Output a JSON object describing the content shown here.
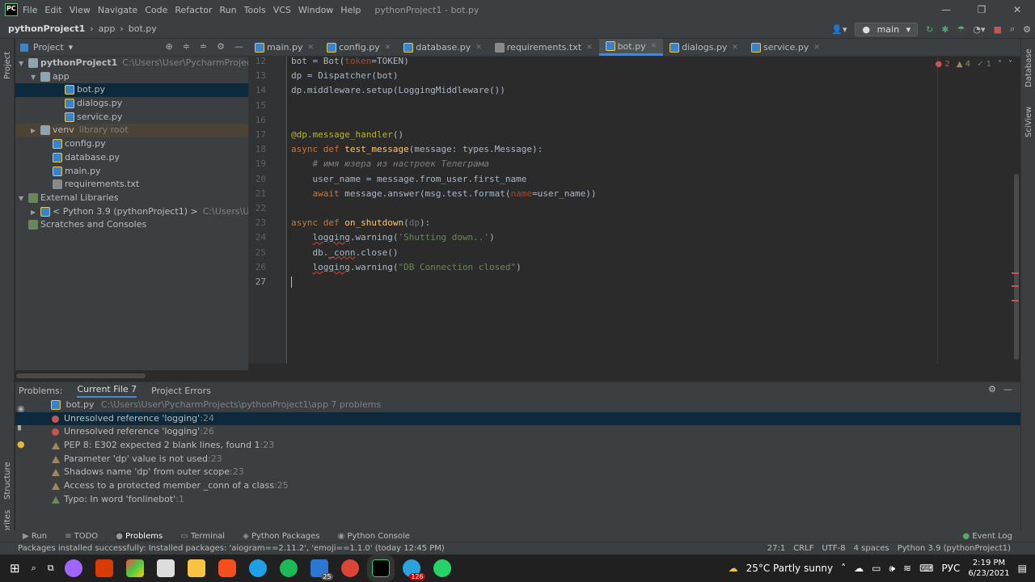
{
  "app": {
    "menu": [
      "File",
      "Edit",
      "View",
      "Navigate",
      "Code",
      "Refactor",
      "Run",
      "Tools",
      "VCS",
      "Window",
      "Help"
    ],
    "title": "pythonProject1 - bot.py"
  },
  "nav": {
    "crumbs": [
      "pythonProject1",
      "app",
      "bot.py"
    ],
    "branch": "main"
  },
  "project_panel": {
    "title": "Project",
    "rows": [
      {
        "name": "pythonProject1",
        "extra": "C:\\Users\\User\\PycharmProjects\\pythonPr",
        "kind": "folder",
        "indent": 0,
        "bold": true
      },
      {
        "name": "app",
        "extra": "",
        "kind": "folder",
        "indent": 1
      },
      {
        "name": "bot.py",
        "extra": "",
        "kind": "py",
        "indent": 3,
        "selected": true
      },
      {
        "name": "dialogs.py",
        "extra": "",
        "kind": "py",
        "indent": 3
      },
      {
        "name": "service.py",
        "extra": "",
        "kind": "py",
        "indent": 3
      },
      {
        "name": "venv",
        "extra": "library root",
        "kind": "folder",
        "indent": 1,
        "venv": true
      },
      {
        "name": "config.py",
        "extra": "",
        "kind": "py",
        "indent": 2
      },
      {
        "name": "database.py",
        "extra": "",
        "kind": "py",
        "indent": 2
      },
      {
        "name": "main.py",
        "extra": "",
        "kind": "py",
        "indent": 2
      },
      {
        "name": "requirements.txt",
        "extra": "",
        "kind": "txt",
        "indent": 2
      },
      {
        "name": "External Libraries",
        "extra": "",
        "kind": "lib",
        "indent": 0
      },
      {
        "name": "< Python 3.9 (pythonProject1) >",
        "extra": "C:\\Users\\User\\Pycharm",
        "kind": "py",
        "indent": 1
      },
      {
        "name": "Scratches and Consoles",
        "extra": "",
        "kind": "lib",
        "indent": 0
      }
    ]
  },
  "tabs": [
    "main.py",
    "config.py",
    "database.py",
    "requirements.txt",
    "bot.py",
    "dialogs.py",
    "service.py"
  ],
  "active_tab": "bot.py",
  "inspections": {
    "errors": "2",
    "warnings": "4",
    "typos": "1"
  },
  "code_lines": [
    {
      "n": "12",
      "html": "bot = Bot(<span class=\"pm\">token</span>=TOKEN)"
    },
    {
      "n": "13",
      "html": "dp = Dispatcher(bot)"
    },
    {
      "n": "14",
      "html": "dp.middleware.setup(LoggingMiddleware())"
    },
    {
      "n": "15",
      "html": ""
    },
    {
      "n": "16",
      "html": ""
    },
    {
      "n": "17",
      "html": "<span class=\"dec\">@dp.message_handler</span>()"
    },
    {
      "n": "18",
      "html": "<span class=\"kw\">async def </span><span class=\"fn\">test_message</span>(message: types.Message):"
    },
    {
      "n": "19",
      "html": "    <span class=\"cm\"># имя юзера из настроек Телеграма</span>"
    },
    {
      "n": "20",
      "html": "    user_name = message.from_user.first_name"
    },
    {
      "n": "21",
      "html": "    <span class=\"kw\">await </span>message.answer(msg.test.format(<span class=\"pm\">name</span>=user_name))"
    },
    {
      "n": "22",
      "html": ""
    },
    {
      "n": "23",
      "html": "<span class=\"kw\">async def </span><span class=\"fn\">on_shutdown</span>(<span class=\"gray\">dp</span>):"
    },
    {
      "n": "24",
      "html": "    <span class=\"squig\">logging</span>.warning(<span class=\"st\">'Shutting down..'</span>)"
    },
    {
      "n": "25",
      "html": "    db.<span class=\"squig\">_conn</span>.close()"
    },
    {
      "n": "26",
      "html": "    <span class=\"squig\">logging</span>.warning(<span class=\"st\">\"DB Connection closed\"</span>)"
    },
    {
      "n": "27",
      "html": ""
    }
  ],
  "problems": {
    "label": "Problems:",
    "tabs": [
      "Current File 7",
      "Project Errors"
    ],
    "file": "bot.py",
    "path": "C:\\Users\\User\\PycharmProjects\\pythonProject1\\app  7 problems",
    "items": [
      {
        "type": "err",
        "text": "Unresolved reference 'logging'",
        "loc": ":24",
        "selected": true
      },
      {
        "type": "err",
        "text": "Unresolved reference 'logging'",
        "loc": ":26"
      },
      {
        "type": "warn",
        "text": "PEP 8: E302 expected 2 blank lines, found 1",
        "loc": ":23"
      },
      {
        "type": "warn",
        "text": "Parameter 'dp' value is not used",
        "loc": ":23"
      },
      {
        "type": "warn",
        "text": "Shadows name 'dp' from outer scope",
        "loc": ":23"
      },
      {
        "type": "warn",
        "text": "Access to a protected member _conn of a class",
        "loc": ":25"
      },
      {
        "type": "typo",
        "text": "Typo: In word 'fonlinebot'",
        "loc": ":1"
      }
    ]
  },
  "bottom_tools": [
    "Run",
    "TODO",
    "Problems",
    "Terminal",
    "Python Packages",
    "Python Console"
  ],
  "event_log": "Event Log",
  "status": {
    "message": "Packages installed successfully: Installed packages: 'aiogram==2.11.2', 'emoji==1.1.0' (today 12:45 PM)",
    "pos": "27:1",
    "eol": "CRLF",
    "enc": "UTF-8",
    "indent": "4 spaces",
    "interp": "Python 3.9 (pythonProject1)"
  },
  "side": {
    "left": [
      "Project",
      "Structure",
      "Favorites"
    ],
    "right": [
      "Database",
      "SciView"
    ]
  },
  "taskbar": {
    "weather": "25°C  Partly sunny",
    "lang": "РУС",
    "time": "2:19 PM",
    "date": "6/23/2021",
    "badges": [
      "25",
      "126"
    ]
  }
}
